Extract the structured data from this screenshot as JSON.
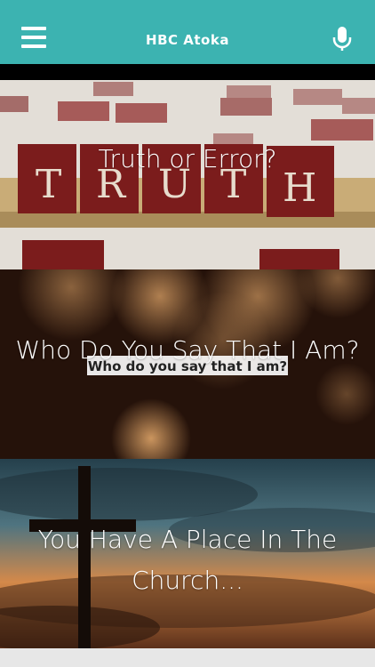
{
  "header": {
    "title": "HBC Atoka",
    "menu_icon": "hamburger-menu-icon",
    "mic_icon": "microphone-icon",
    "background": "#3cb3b1"
  },
  "cards": [
    {
      "caption": "Truth or Error?",
      "image_text": "T R U T H"
    },
    {
      "caption": "Who Do You Say That I Am?",
      "image_text": "Who do you say that I am?"
    },
    {
      "caption": "You Have A Place In The Church..."
    }
  ]
}
